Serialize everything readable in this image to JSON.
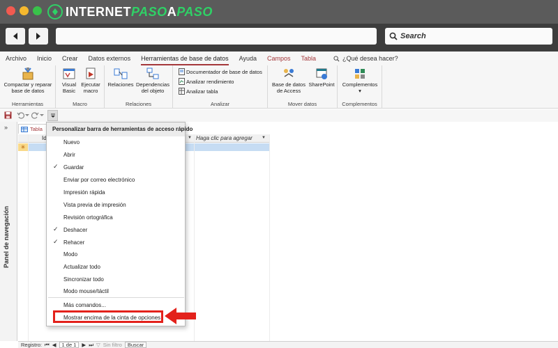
{
  "browser": {
    "logo": {
      "part1": "INTERNET",
      "part2": "PASO",
      "part3": "A",
      "part4": "PASO"
    },
    "search_placeholder": "Search"
  },
  "ribbon": {
    "tabs": [
      "Archivo",
      "Inicio",
      "Crear",
      "Datos externos",
      "Herramientas de base de datos",
      "Ayuda",
      "Campos",
      "Tabla"
    ],
    "active_tab": "Herramientas de base de datos",
    "tell_me": "¿Qué desea hacer?",
    "groups": {
      "herramientas": {
        "label": "Herramientas",
        "compact_line1": "Compactar y reparar",
        "compact_line2": "base de datos"
      },
      "macro": {
        "label": "Macro",
        "visual_line1": "Visual",
        "visual_line2": "Basic",
        "run_line1": "Ejecutar",
        "run_line2": "macro"
      },
      "relaciones": {
        "label": "Relaciones",
        "relations": "Relaciones",
        "deps_line1": "Dependencias",
        "deps_line2": "del objeto"
      },
      "analizar": {
        "label": "Analizar",
        "documenter": "Documentador de base de datos",
        "performance": "Analizar rendimiento",
        "table": "Analizar tabla"
      },
      "mover": {
        "label": "Mover datos",
        "access_line1": "Base de datos",
        "access_line2": "de Access",
        "sharepoint": "SharePoint"
      },
      "complementos": {
        "label": "Complementos",
        "addins": "Complementos",
        "addins_arrow": "▾"
      }
    }
  },
  "navpane": {
    "label": "Panel de navegación",
    "arrows": "»"
  },
  "document": {
    "tab_label": "Tabla",
    "id_header": "Id",
    "add_header": "Haga clic para agregar"
  },
  "status": {
    "record_label": "Registro:",
    "record_value": "1 de 1",
    "no_filter": "Sin filtro",
    "search": "Buscar"
  },
  "menu": {
    "title": "Personalizar barra de herramientas de acceso rápido",
    "items": [
      {
        "label": "Nuevo",
        "checked": false
      },
      {
        "label": "Abrir",
        "checked": false
      },
      {
        "label": "Guardar",
        "checked": true
      },
      {
        "label": "Enviar por correo electrónico",
        "checked": false
      },
      {
        "label": "Impresión rápida",
        "checked": false
      },
      {
        "label": "Vista previa de impresión",
        "checked": false
      },
      {
        "label": "Revisión ortográfica",
        "checked": false
      },
      {
        "label": "Deshacer",
        "checked": true
      },
      {
        "label": "Rehacer",
        "checked": true
      },
      {
        "label": "Modo",
        "checked": false
      },
      {
        "label": "Actualizar todo",
        "checked": false
      },
      {
        "label": "Sincronizar todo",
        "checked": false
      },
      {
        "label": "Modo mouse/táctil",
        "checked": false
      },
      {
        "label": "Más comandos...",
        "checked": false
      },
      {
        "label": "Mostrar encima de la cinta de opciones",
        "checked": false
      }
    ],
    "check_glyph": "✓"
  },
  "colors": {
    "accent": "#a4373a",
    "highlight": "#e3211b",
    "selected_row": "#c6dcf3",
    "logo_green": "#2fd166"
  }
}
